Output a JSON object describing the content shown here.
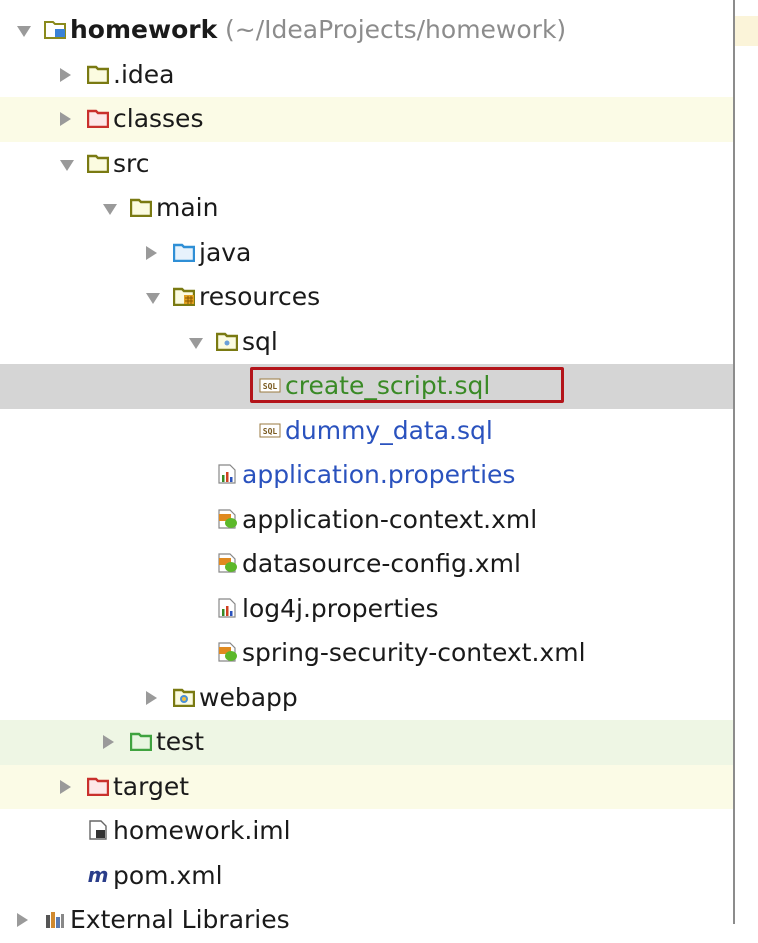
{
  "tree": {
    "items": [
      {
        "label": "homework",
        "suffix": "(~/IdeaProjects/homework)",
        "icon": "module-folder-icon",
        "depth": 0,
        "state": "expanded",
        "style": "bold",
        "bg": "none"
      },
      {
        "label": ".idea",
        "icon": "folder-icon",
        "depth": 1,
        "state": "collapsed",
        "style": "normal",
        "bg": "none"
      },
      {
        "label": "classes",
        "icon": "excluded-folder-icon",
        "depth": 1,
        "state": "collapsed",
        "style": "normal",
        "bg": "yellow"
      },
      {
        "label": "src",
        "icon": "folder-icon",
        "depth": 1,
        "state": "expanded",
        "style": "normal",
        "bg": "none"
      },
      {
        "label": "main",
        "icon": "folder-icon",
        "depth": 2,
        "state": "expanded",
        "style": "normal",
        "bg": "none"
      },
      {
        "label": "java",
        "icon": "source-folder-icon",
        "depth": 3,
        "state": "collapsed",
        "style": "normal",
        "bg": "none"
      },
      {
        "label": "resources",
        "icon": "resources-folder-icon",
        "depth": 3,
        "state": "expanded",
        "style": "normal",
        "bg": "none"
      },
      {
        "label": "sql",
        "icon": "package-folder-icon",
        "depth": 4,
        "state": "expanded",
        "style": "normal",
        "bg": "none"
      },
      {
        "label": "create_script.sql",
        "icon": "sql-file-icon",
        "depth": 5,
        "state": "leaf",
        "style": "green",
        "bg": "selected",
        "highlighted": true
      },
      {
        "label": "dummy_data.sql",
        "icon": "sql-file-icon",
        "depth": 5,
        "state": "leaf",
        "style": "blue",
        "bg": "none"
      },
      {
        "label": "application.properties",
        "icon": "properties-file-icon",
        "depth": 4,
        "state": "leaf",
        "style": "blue",
        "bg": "none"
      },
      {
        "label": "application-context.xml",
        "icon": "spring-xml-icon",
        "depth": 4,
        "state": "leaf",
        "style": "normal",
        "bg": "none"
      },
      {
        "label": "datasource-config.xml",
        "icon": "spring-xml-icon",
        "depth": 4,
        "state": "leaf",
        "style": "normal",
        "bg": "none"
      },
      {
        "label": "log4j.properties",
        "icon": "properties-file-icon",
        "depth": 4,
        "state": "leaf",
        "style": "normal",
        "bg": "none"
      },
      {
        "label": "spring-security-context.xml",
        "icon": "spring-xml-icon",
        "depth": 4,
        "state": "leaf",
        "style": "normal",
        "bg": "none"
      },
      {
        "label": "webapp",
        "icon": "web-folder-icon",
        "depth": 3,
        "state": "collapsed",
        "style": "normal",
        "bg": "none"
      },
      {
        "label": "test",
        "icon": "test-folder-icon",
        "depth": 2,
        "state": "collapsed",
        "style": "normal",
        "bg": "green"
      },
      {
        "label": "target",
        "icon": "excluded-folder-icon",
        "depth": 1,
        "state": "collapsed",
        "style": "normal",
        "bg": "yellow"
      },
      {
        "label": "homework.iml",
        "icon": "iml-file-icon",
        "depth": 1,
        "state": "leaf",
        "style": "normal",
        "bg": "none"
      },
      {
        "label": "pom.xml",
        "icon": "maven-file-icon",
        "depth": 1,
        "state": "leaf",
        "style": "normal",
        "bg": "none"
      },
      {
        "label": "External Libraries",
        "icon": "libraries-icon",
        "depth": 0,
        "state": "collapsed",
        "style": "normal",
        "bg": "none"
      }
    ]
  },
  "colors": {
    "accent_selection_border": "#b3141a",
    "text_blue": "#2a52be",
    "text_green": "#3a8a26",
    "folder_olive": "#6b6b1f",
    "folder_red": "#c9302c",
    "folder_blue": "#2f8fd6",
    "folder_green": "#3fa33f"
  }
}
